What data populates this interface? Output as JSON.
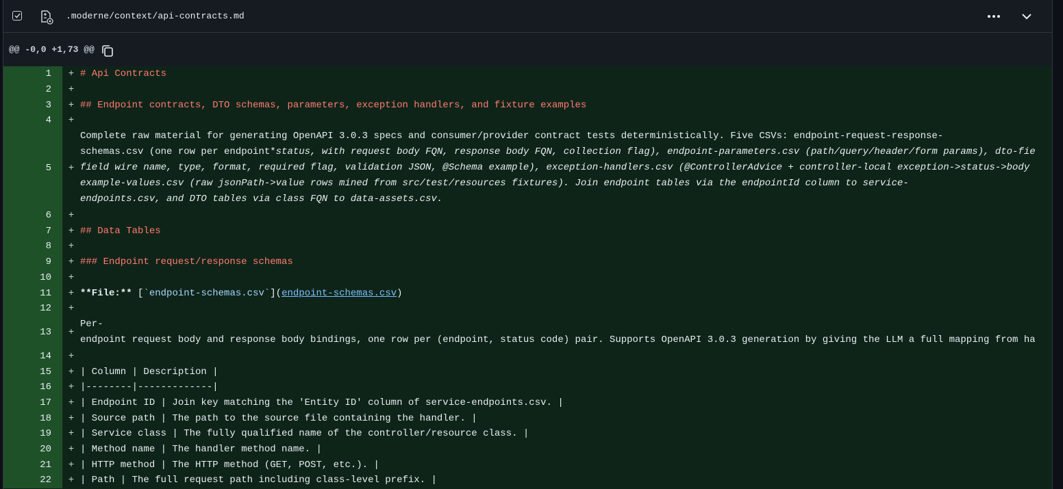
{
  "file": {
    "name": ".moderne/context/api-contracts.md"
  },
  "hunk": {
    "header": "@@ -0,0 +1,73 @@"
  },
  "icons": {
    "checkbox": "checkbox-checked-icon",
    "file": "file-diff-icon",
    "more": "kebab-horizontal-icon",
    "collapse": "chevron-down-icon",
    "copy": "copy-icon"
  },
  "colors": {
    "gutter": "#1f5129",
    "added_bg": "#0f2418",
    "heading": "#ff7b72",
    "link": "#79c0ff"
  },
  "lines": [
    {
      "num": "1",
      "sign": "+",
      "text": "# Api Contracts"
    },
    {
      "num": "2",
      "sign": "+",
      "text": ""
    },
    {
      "num": "3",
      "sign": "+",
      "text": "## Endpoint contracts, DTO schemas, parameters, exception handlers, and fixture examples"
    },
    {
      "num": "4",
      "sign": "+",
      "text": ""
    },
    {
      "num": "5",
      "sign": "+",
      "text_lines": [
        "Complete raw material for generating OpenAPI 3.0.3 specs and consumer/provider contract tests deterministically. Five CSVs: endpoint-request-response-",
        "schemas.csv (one row per endpoint*status, with request body FQN, response body FQN, collection flag), endpoint-parameters.csv (path/query/header/form params), dto-fie",
        "field wire name, type, format, required flag, validation JSON, @Schema example), exception-handlers.csv (@ControllerAdvice + controller-local exception->status->body",
        "example-values.csv (raw jsonPath->value rows mined from src/test/resources fixtures). Join endpoint tables via the endpointId column to service-",
        "endpoints.csv, and DTO tables via class FQN to data-assets.csv."
      ]
    },
    {
      "num": "6",
      "sign": "+",
      "text": ""
    },
    {
      "num": "7",
      "sign": "+",
      "text": "## Data Tables"
    },
    {
      "num": "8",
      "sign": "+",
      "text": ""
    },
    {
      "num": "9",
      "sign": "+",
      "text": "### Endpoint request/response schemas"
    },
    {
      "num": "10",
      "sign": "+",
      "text": ""
    },
    {
      "num": "11",
      "sign": "+",
      "file_prefix": "**File:**",
      "file_open": " [",
      "file_code": "`endpoint-schemas.csv`",
      "file_mid": "](",
      "file_link": "endpoint-schemas.csv",
      "file_close": ")"
    },
    {
      "num": "12",
      "sign": "+",
      "text": ""
    },
    {
      "num": "13",
      "sign": "+",
      "text_lines": [
        "Per-",
        "endpoint request body and response body bindings, one row per (endpoint, status code) pair. Supports OpenAPI 3.0.3 generation by giving the LLM a full mapping from ha"
      ]
    },
    {
      "num": "14",
      "sign": "+",
      "text": ""
    },
    {
      "num": "15",
      "sign": "+",
      "text": "| Column | Description |"
    },
    {
      "num": "16",
      "sign": "+",
      "text": "|--------|-------------|"
    },
    {
      "num": "17",
      "sign": "+",
      "text": "| Endpoint ID | Join key matching the 'Entity ID' column of service-endpoints.csv. |"
    },
    {
      "num": "18",
      "sign": "+",
      "text": "| Source path | The path to the source file containing the handler. |"
    },
    {
      "num": "19",
      "sign": "+",
      "text": "| Service class | The fully qualified name of the controller/resource class. |"
    },
    {
      "num": "20",
      "sign": "+",
      "text": "| Method name | The handler method name. |"
    },
    {
      "num": "21",
      "sign": "+",
      "text": "| HTTP method | The HTTP method (GET, POST, etc.). |"
    },
    {
      "num": "22",
      "sign": "+",
      "text": "| Path | The full request path including class-level prefix. |"
    }
  ]
}
